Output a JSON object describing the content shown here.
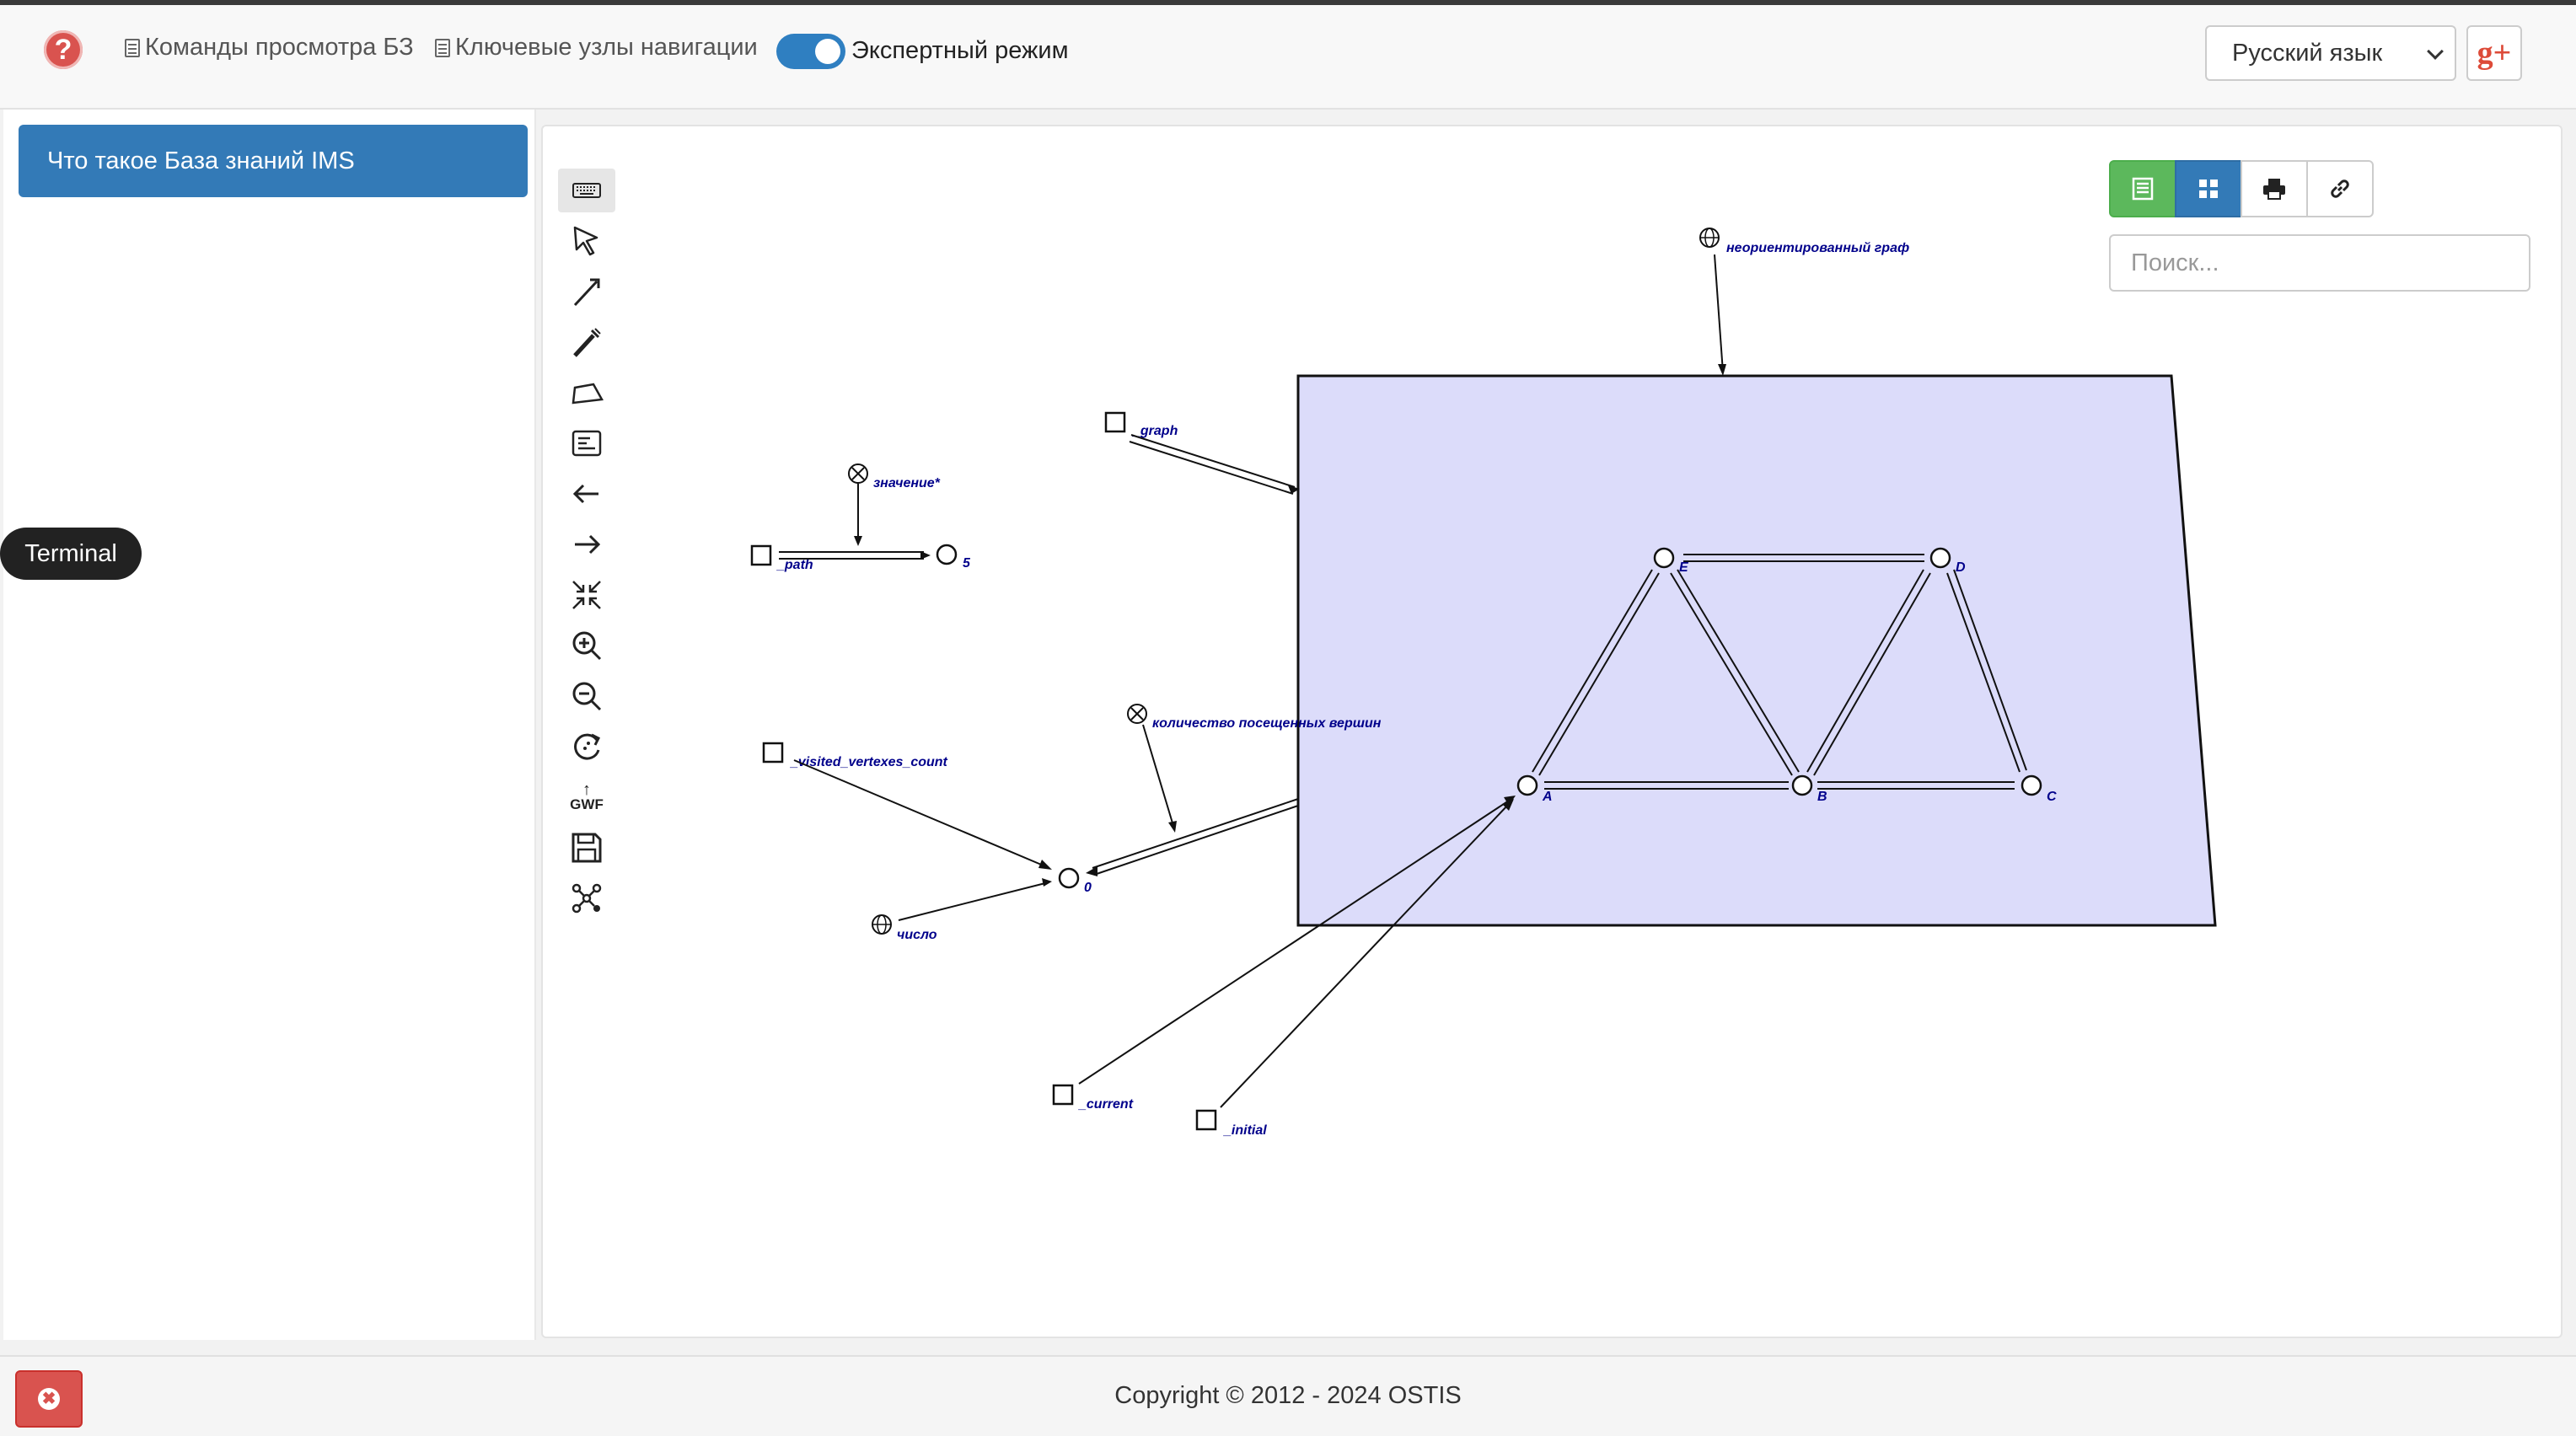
{
  "navbar": {
    "help_icon": "question-circle-icon",
    "commands_label": "Команды просмотра БЗ",
    "key_nodes_label": "Ключевые узлы навигации",
    "expert_mode_label": "Экспертный режим",
    "expert_mode_on": true,
    "language": "Русский язык",
    "gplus_label": "g+"
  },
  "sidebar": {
    "kb_button_label": "Что такое База знаний IMS",
    "terminal_label": "Terminal"
  },
  "toolbar": {
    "tools": [
      "keyboard-icon",
      "select-icon",
      "edge-icon",
      "bus-icon",
      "contour-icon",
      "link-icon",
      "back-icon",
      "forward-icon",
      "collapse-icon",
      "zoom-in-icon",
      "zoom-out-icon",
      "layout-icon",
      "gwf-upload-icon",
      "save-icon",
      "graph-icon"
    ],
    "gwf_label": "GWF"
  },
  "view_buttons": [
    "text-view-icon",
    "scg-view-icon",
    "print-icon",
    "link-icon"
  ],
  "search": {
    "placeholder": "Поиск..."
  },
  "graph": {
    "labels": {
      "undirected_graph": "неориентированный граф",
      "graph": "_graph",
      "value": "значение*",
      "path": "_path",
      "five": "5",
      "visited_count_relation": "количество посещенных вершин",
      "visited_vertexes_count": "_visited_vertexes_count",
      "zero": "0",
      "number": "число",
      "current": "_current",
      "initial": "_initial",
      "A": "A",
      "B": "B",
      "C": "C",
      "D": "D",
      "E": "E"
    },
    "contour_fill": "#dcdcfa"
  },
  "footer": {
    "copyright": "Copyright © 2012 - 2024 OSTIS",
    "close_icon": "close-circle-icon"
  },
  "colors": {
    "primary": "#337ab7",
    "success": "#5cb85c",
    "danger": "#d9534f",
    "label": "#00008b"
  }
}
